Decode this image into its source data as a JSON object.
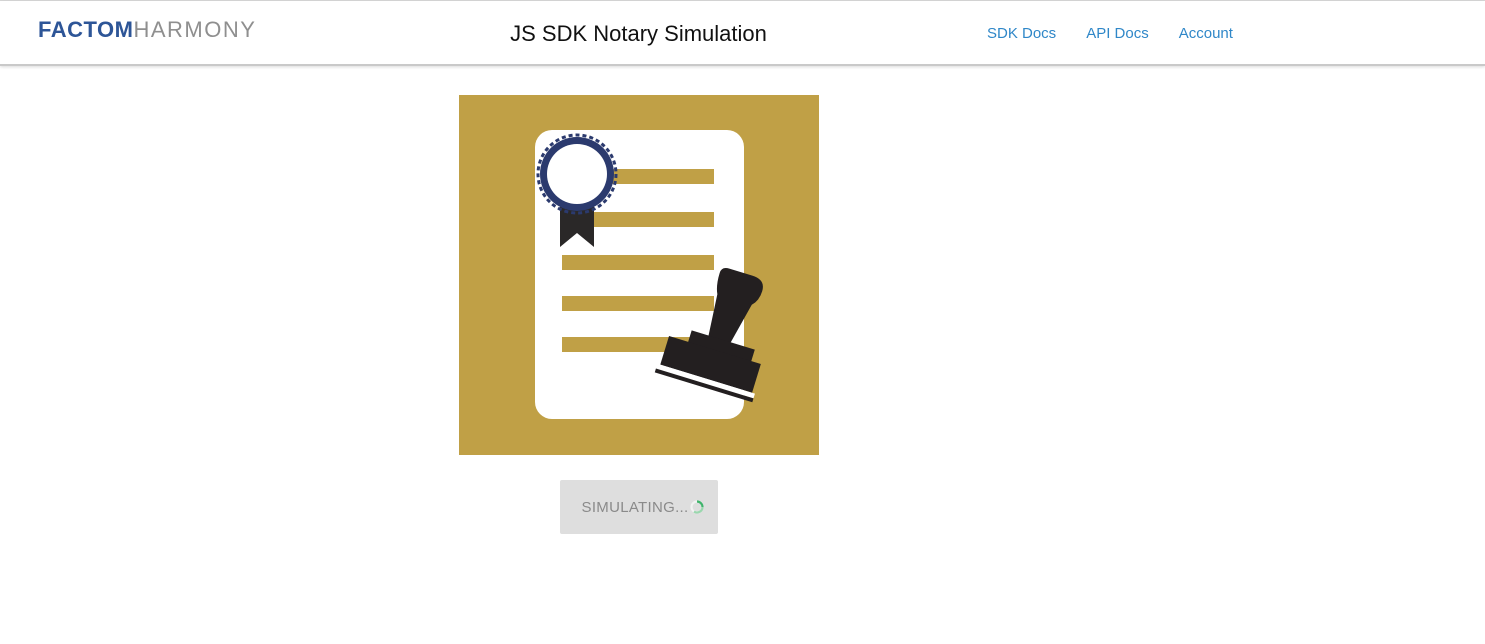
{
  "header": {
    "logo_brand": "FACTOM",
    "logo_product": "HARMONY",
    "title": "JS SDK Notary Simulation",
    "nav": [
      {
        "label": "SDK Docs"
      },
      {
        "label": "API Docs"
      },
      {
        "label": "Account"
      }
    ]
  },
  "main": {
    "illustration_icon": "notarized-certificate-with-stamp",
    "simulate_button": {
      "label": "SIMULATING...",
      "state": "loading",
      "spinner_icon": "loading-spinner-icon"
    }
  },
  "colors": {
    "brand_blue": "#2d5597",
    "link_blue": "#2f87c8",
    "gold": "#c0a046",
    "ribbon_navy": "#2b3a6e",
    "stamp_black": "#231f20",
    "button_gray": "#dedede",
    "spinner_green": "#3fb36b"
  }
}
